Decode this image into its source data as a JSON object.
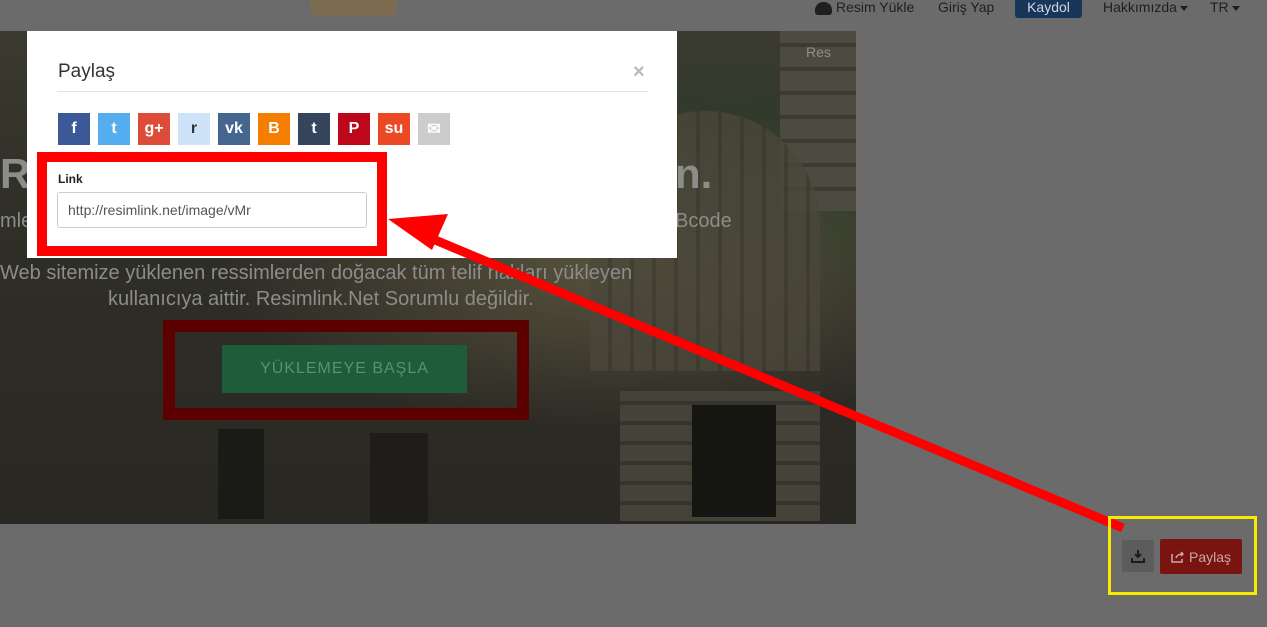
{
  "nav": {
    "upload": "Resim Yükle",
    "login": "Giriş Yap",
    "register": "Kaydol",
    "about": "Hakkımızda",
    "lang": "TR"
  },
  "hero": {
    "title_left": "Re",
    "title_right": "n.",
    "sub_left": "mle",
    "sub_right": "Bcode",
    "line1": "Web sitemize yüklenen ressimlerden doğacak tüm telif hakları yükleyen",
    "line2": "kullanıcıya aittir. Resimlink.Net Sorumlu değildir.",
    "cta": "YÜKLEMEYE BAŞLA",
    "cloud_hint": "Res"
  },
  "modal": {
    "title": "Paylaş",
    "close": "×",
    "link_label": "Link",
    "link_value": "http://resimlink.net/image/vMr",
    "share_icons": [
      {
        "name": "facebook-icon",
        "glyph": "f",
        "color": "#3b5998"
      },
      {
        "name": "twitter-icon",
        "glyph": "t",
        "color": "#55acee"
      },
      {
        "name": "google-plus-icon",
        "glyph": "g+",
        "color": "#dd4b39"
      },
      {
        "name": "reddit-icon",
        "glyph": "r",
        "color": "#cee3f8"
      },
      {
        "name": "vk-icon",
        "glyph": "vk",
        "color": "#45668e"
      },
      {
        "name": "blogger-icon",
        "glyph": "B",
        "color": "#f57d00"
      },
      {
        "name": "tumblr-icon",
        "glyph": "t",
        "color": "#35465c"
      },
      {
        "name": "pinterest-icon",
        "glyph": "P",
        "color": "#bd081c"
      },
      {
        "name": "stumbleupon-icon",
        "glyph": "su",
        "color": "#eb4924"
      },
      {
        "name": "email-icon",
        "glyph": "✉",
        "color": "#cccccc"
      }
    ]
  },
  "actions": {
    "download_icon": "download-icon",
    "share_label": "Paylaş"
  },
  "colors": {
    "annotation_red": "#ff0000",
    "annotation_yellow": "#f7ec00"
  }
}
